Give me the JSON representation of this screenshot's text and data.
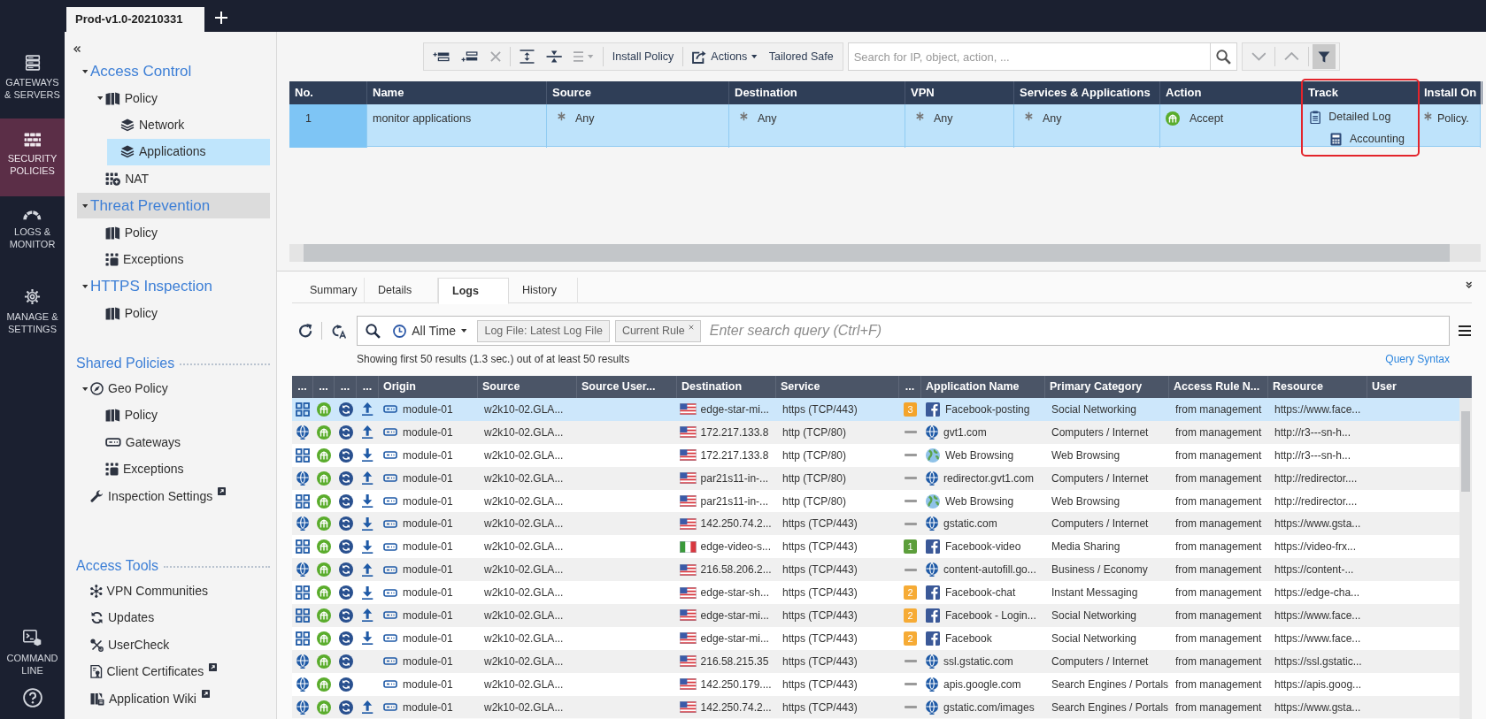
{
  "top_bar": {
    "tabs": [
      {
        "label": "Prod-v1.0-20210331",
        "selected": true
      }
    ]
  },
  "rail": {
    "items": [
      {
        "kind": "gateways",
        "label": "GATEWAYS & SERVERS",
        "selected": false
      },
      {
        "kind": "policies",
        "label": "SECURITY POLICIES",
        "selected": true
      },
      {
        "kind": "logs",
        "label": "LOGS & MONITOR",
        "selected": false
      },
      {
        "kind": "manage",
        "label": "MANAGE & SETTINGS",
        "selected": false
      }
    ],
    "bottom_items": [
      {
        "kind": "command",
        "label": "COMMAND LINE",
        "selected": false
      },
      {
        "kind": "help",
        "selected": false
      }
    ]
  },
  "nav": {
    "tree": [
      {
        "kind": "category",
        "label": "Access Control",
        "expanded": true,
        "selected": false,
        "highlighted": false,
        "children": [
          {
            "kind": "policy",
            "label": "Policy",
            "expanded": true,
            "selected": false,
            "highlighted": false,
            "children": [
              {
                "kind": "layer",
                "label": "Network",
                "selected": false,
                "highlighted": false
              },
              {
                "kind": "layer",
                "label": "Applications",
                "selected": true,
                "highlighted": false
              }
            ]
          },
          {
            "kind": "nat",
            "label": "NAT",
            "selected": false,
            "highlighted": false
          }
        ]
      },
      {
        "kind": "category",
        "label": "Threat Prevention",
        "expanded": true,
        "selected": false,
        "highlighted": true,
        "children": [
          {
            "kind": "policy",
            "label": "Policy",
            "selected": false,
            "highlighted": false
          },
          {
            "kind": "exceptions",
            "label": "Exceptions",
            "selected": false,
            "highlighted": false
          }
        ]
      },
      {
        "kind": "category",
        "label": "HTTPS Inspection",
        "expanded": true,
        "selected": false,
        "highlighted": false,
        "children": [
          {
            "kind": "policy",
            "label": "Policy",
            "selected": false,
            "highlighted": false
          }
        ]
      }
    ],
    "shared_policies": {
      "title": "Shared Policies",
      "items": [
        {
          "kind": "geo",
          "label": "Geo Policy",
          "expanded": true,
          "selected": false,
          "external": false,
          "children": [
            {
              "kind": "policy",
              "label": "Policy",
              "selected": false,
              "external": false
            },
            {
              "kind": "gateways",
              "label": "Gateways",
              "selected": false,
              "external": false
            },
            {
              "kind": "exceptions",
              "label": "Exceptions",
              "selected": false,
              "external": false
            }
          ]
        },
        {
          "kind": "settings",
          "label": "Inspection Settings",
          "selected": false,
          "external": true
        }
      ]
    },
    "access_tools": {
      "title": "Access Tools",
      "items": [
        {
          "kind": "vpn",
          "label": "VPN Communities",
          "selected": false,
          "external": false
        },
        {
          "kind": "updates",
          "label": "Updates",
          "selected": false,
          "external": false
        },
        {
          "kind": "usercheck",
          "label": "UserCheck",
          "selected": false,
          "external": false
        },
        {
          "kind": "certificates",
          "label": "Client Certificates",
          "selected": false,
          "external": true
        },
        {
          "kind": "wiki",
          "label": "Application Wiki",
          "selected": false,
          "external": true
        }
      ]
    }
  },
  "toolbar": {
    "buttons": [
      {
        "kind": "insert-above",
        "disabled": false
      },
      {
        "kind": "insert-below",
        "disabled": false
      },
      {
        "kind": "delete",
        "disabled": true
      },
      {
        "kind": "divider"
      },
      {
        "kind": "expand",
        "disabled": false
      },
      {
        "kind": "collapse",
        "disabled": false
      },
      {
        "kind": "list",
        "disabled": true
      },
      {
        "kind": "divider"
      },
      {
        "kind": "text",
        "label": "Install Policy",
        "disabled": false
      },
      {
        "kind": "divider"
      },
      {
        "kind": "actions",
        "label": "Actions",
        "disabled": false
      },
      {
        "kind": "text",
        "label": "Tailored Safe",
        "disabled": false
      }
    ],
    "search": {
      "placeholder": "Search for IP, object, action, ..."
    },
    "navigation": [
      {
        "kind": "next",
        "disabled": true
      },
      {
        "kind": "previous",
        "disabled": true
      }
    ],
    "filter_active": true
  },
  "rule_table": {
    "columns": [
      {
        "label": "No.",
        "highlighted": false
      },
      {
        "label": "Name",
        "highlighted": false
      },
      {
        "label": "Source",
        "highlighted": false
      },
      {
        "label": "Destination",
        "highlighted": false
      },
      {
        "label": "VPN",
        "highlighted": false
      },
      {
        "label": "Services & Applications",
        "highlighted": false
      },
      {
        "label": "Action",
        "highlighted": false
      },
      {
        "label": "Track",
        "highlighted": true
      },
      {
        "label": "Install On",
        "highlighted": false
      }
    ],
    "rows": [
      {
        "selected": true,
        "no": "1",
        "name": "monitor applications",
        "source": "Any",
        "destination": "Any",
        "vpn": "Any",
        "services": "Any",
        "action": "Accept",
        "track": [
          {
            "kind": "log",
            "label": "Detailed Log"
          },
          {
            "kind": "accounting",
            "label": "Accounting"
          }
        ],
        "install_on": "Policy."
      }
    ]
  },
  "details": {
    "tabs": [
      {
        "label": "Summary",
        "selected": false
      },
      {
        "label": "Details",
        "selected": false
      },
      {
        "label": "Logs",
        "selected": true
      },
      {
        "label": "History",
        "selected": false
      }
    ],
    "logs": {
      "time_filter": "All Time",
      "chips": [
        {
          "label": "Log File: Latest Log File",
          "removable": false
        },
        {
          "label": "Current Rule",
          "removable": true
        }
      ],
      "query": {
        "placeholder": "Enter search query (Ctrl+F)"
      },
      "status": "Showing first 50 results (1.3 sec.) out of at least 50 results",
      "query_syntax_link": "Query Syntax",
      "table": {
        "columns": [
          "...",
          "...",
          "...",
          "...",
          "Origin",
          "Source",
          "Source User...",
          "Destination",
          "Service",
          "...",
          "Application Name",
          "Primary Category",
          "Access Rule N...",
          "Resource",
          "User"
        ],
        "rows": [
          {
            "selected": true,
            "blade": {
              "kind": "grid"
            },
            "direction": {
              "kind": "up"
            },
            "origin": "module-01",
            "source": "w2k10-02.GLA...",
            "destination": {
              "kind": "us",
              "text": "edge-star-mi..."
            },
            "service": "https (TCP/443)",
            "risk": {
              "label": "3",
              "color": "#f4a42b"
            },
            "application": {
              "kind": "facebook",
              "text": "Facebook-posting"
            },
            "category": "Social Networking",
            "rule": "from management",
            "resource": "https://www.face..."
          },
          {
            "selected": false,
            "blade": {
              "kind": "pin"
            },
            "direction": {
              "kind": "up"
            },
            "origin": "module-01",
            "source": "w2k10-02.GLA...",
            "destination": {
              "kind": "us",
              "text": "172.217.133.8"
            },
            "service": "http (TCP/80)",
            "application": {
              "kind": "pin",
              "text": "gvt1.com"
            },
            "category": "Computers / Internet",
            "rule": "from management",
            "resource": "http://r3---sn-h..."
          },
          {
            "selected": false,
            "blade": {
              "kind": "grid"
            },
            "direction": {
              "kind": "down"
            },
            "origin": "module-01",
            "source": "w2k10-02.GLA...",
            "destination": {
              "kind": "us",
              "text": "172.217.133.8"
            },
            "service": "http (TCP/80)",
            "application": {
              "kind": "earth",
              "text": "Web Browsing"
            },
            "category": "Web Browsing",
            "rule": "from management",
            "resource": "http://r3---sn-h..."
          },
          {
            "selected": false,
            "blade": {
              "kind": "pin"
            },
            "direction": {
              "kind": "up"
            },
            "origin": "module-01",
            "source": "w2k10-02.GLA...",
            "destination": {
              "kind": "us",
              "text": "par21s11-in-..."
            },
            "service": "http (TCP/80)",
            "application": {
              "kind": "pin",
              "text": "redirector.gvt1.com"
            },
            "category": "Computers / Internet",
            "rule": "from management",
            "resource": "http://redirector...."
          },
          {
            "selected": false,
            "blade": {
              "kind": "grid"
            },
            "direction": {
              "kind": "down"
            },
            "origin": "module-01",
            "source": "w2k10-02.GLA...",
            "destination": {
              "kind": "us",
              "text": "par21s11-in-..."
            },
            "service": "http (TCP/80)",
            "application": {
              "kind": "earth",
              "text": "Web Browsing"
            },
            "category": "Web Browsing",
            "rule": "from management",
            "resource": "http://redirector...."
          },
          {
            "selected": false,
            "blade": {
              "kind": "pin"
            },
            "direction": {
              "kind": "down"
            },
            "origin": "module-01",
            "source": "w2k10-02.GLA...",
            "destination": {
              "kind": "us",
              "text": "142.250.74.2..."
            },
            "service": "https (TCP/443)",
            "application": {
              "kind": "pin",
              "text": "gstatic.com"
            },
            "category": "Computers / Internet",
            "rule": "from management",
            "resource": "https://www.gsta..."
          },
          {
            "selected": false,
            "blade": {
              "kind": "grid"
            },
            "direction": {
              "kind": "down"
            },
            "origin": "module-01",
            "source": "w2k10-02.GLA...",
            "destination": {
              "kind": "it",
              "text": "edge-video-s..."
            },
            "service": "https (TCP/443)",
            "risk": {
              "label": "1",
              "color": "#5c9e3b"
            },
            "application": {
              "kind": "facebook",
              "text": "Facebook-video"
            },
            "category": "Media Sharing",
            "rule": "from management",
            "resource": "https://video-frx..."
          },
          {
            "selected": false,
            "blade": {
              "kind": "pin"
            },
            "direction": {
              "kind": "up"
            },
            "origin": "module-01",
            "source": "w2k10-02.GLA...",
            "destination": {
              "kind": "us",
              "text": "216.58.206.2..."
            },
            "service": "https (TCP/443)",
            "application": {
              "kind": "pin",
              "text": "content-autofill.go..."
            },
            "category": "Business / Economy",
            "rule": "from management",
            "resource": "https://content-..."
          },
          {
            "selected": false,
            "blade": {
              "kind": "grid"
            },
            "direction": {
              "kind": "down"
            },
            "origin": "module-01",
            "source": "w2k10-02.GLA...",
            "destination": {
              "kind": "us",
              "text": "edge-star-sh..."
            },
            "service": "https (TCP/443)",
            "risk": {
              "label": "2",
              "color": "#f6ab35"
            },
            "application": {
              "kind": "facebook",
              "text": "Facebook-chat"
            },
            "category": "Instant Messaging",
            "rule": "from management",
            "resource": "https://edge-cha..."
          },
          {
            "selected": false,
            "blade": {
              "kind": "grid"
            },
            "direction": {
              "kind": "up"
            },
            "origin": "module-01",
            "source": "w2k10-02.GLA...",
            "destination": {
              "kind": "us",
              "text": "edge-star-mi..."
            },
            "service": "https (TCP/443)",
            "risk": {
              "label": "2",
              "color": "#f6ab35"
            },
            "application": {
              "kind": "facebook",
              "text": "Facebook - Login..."
            },
            "category": "Social Networking",
            "rule": "from management",
            "resource": "https://www.face..."
          },
          {
            "selected": false,
            "blade": {
              "kind": "grid"
            },
            "direction": {
              "kind": "down"
            },
            "origin": "module-01",
            "source": "w2k10-02.GLA...",
            "destination": {
              "kind": "us",
              "text": "edge-star-mi..."
            },
            "service": "https (TCP/443)",
            "risk": {
              "label": "2",
              "color": "#f6ab35"
            },
            "application": {
              "kind": "facebook",
              "text": "Facebook"
            },
            "category": "Social Networking",
            "rule": "from management",
            "resource": "https://www.face..."
          },
          {
            "selected": false,
            "blade": {
              "kind": "pin"
            },
            "origin": "module-01",
            "source": "w2k10-02.GLA...",
            "destination": {
              "kind": "us",
              "text": "216.58.215.35"
            },
            "service": "https (TCP/443)",
            "application": {
              "kind": "pin",
              "text": "ssl.gstatic.com"
            },
            "category": "Computers / Internet",
            "rule": "from management",
            "resource": "https://ssl.gstatic..."
          },
          {
            "selected": false,
            "blade": {
              "kind": "pin"
            },
            "origin": "module-01",
            "source": "w2k10-02.GLA...",
            "destination": {
              "kind": "us",
              "text": "142.250.179...."
            },
            "service": "https (TCP/443)",
            "application": {
              "kind": "pin",
              "text": "apis.google.com"
            },
            "category": "Search Engines / Portals",
            "rule": "from management",
            "resource": "https://apis.goog..."
          },
          {
            "selected": false,
            "blade": {
              "kind": "pin"
            },
            "direction": {
              "kind": "up"
            },
            "origin": "module-01",
            "source": "w2k10-02.GLA...",
            "destination": {
              "kind": "us",
              "text": "142.250.74.2..."
            },
            "service": "https (TCP/443)",
            "application": {
              "kind": "pin",
              "text": "gstatic.com/images"
            },
            "category": "Search Engines / Portals",
            "rule": "from management",
            "resource": "https://www.gsta..."
          }
        ]
      }
    }
  }
}
